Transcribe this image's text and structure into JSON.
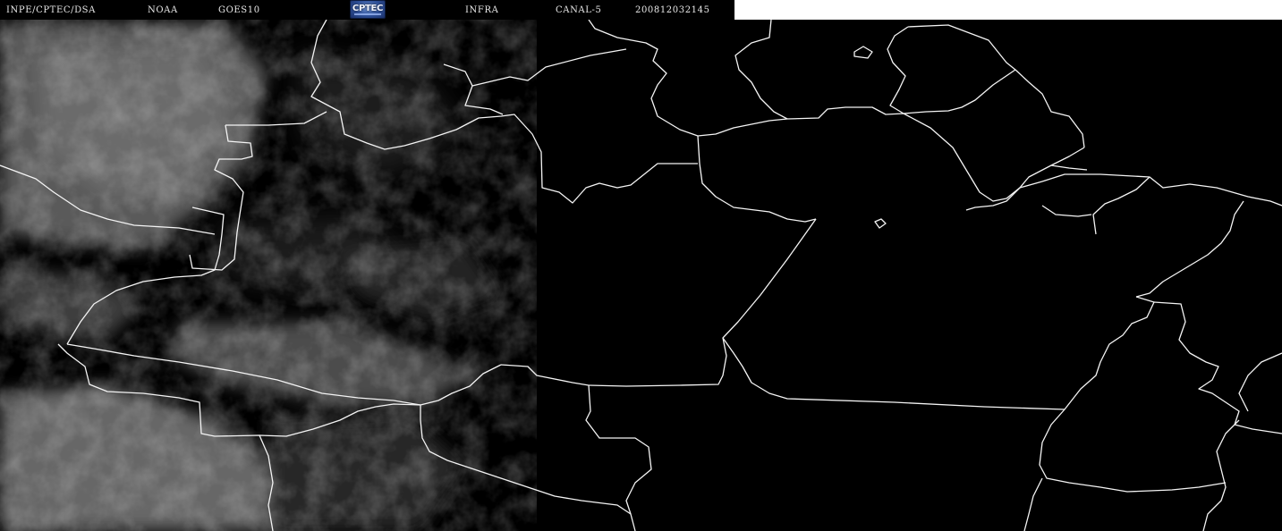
{
  "header": {
    "institution": "INPE/CPTEC/DSA",
    "agency": "NOAA",
    "satellite": "GOES10",
    "logo_text": "CPTEC",
    "product": "INFRA",
    "channel": "CANAL-5",
    "timestamp": "200812032145"
  },
  "map": {
    "background_color": "#000000",
    "border_color": "#f4f4f4",
    "cloud_color": "#8c8c8c"
  }
}
